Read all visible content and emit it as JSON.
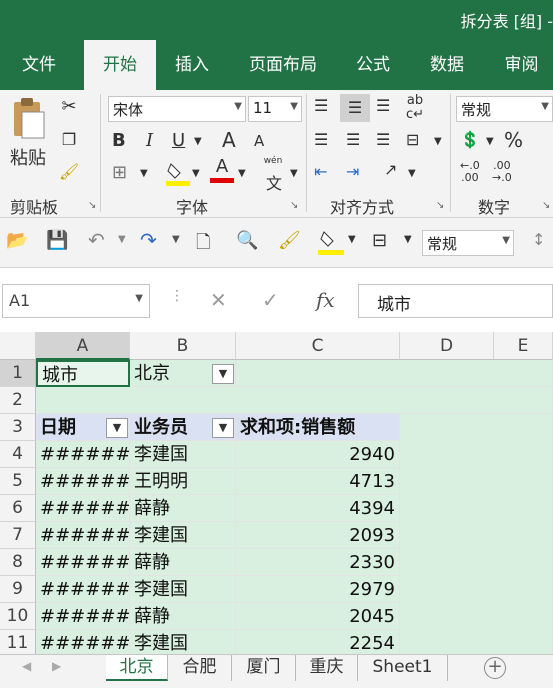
{
  "window": {
    "title": "拆分表 [组] -"
  },
  "tabs": [
    "文件",
    "开始",
    "插入",
    "页面布局",
    "公式",
    "数据",
    "审阅"
  ],
  "ribbon": {
    "clipboard": {
      "label": "剪贴板",
      "paste": "粘贴"
    },
    "font": {
      "label": "字体",
      "name": "宋体",
      "size": "11",
      "bold": "B",
      "italic": "I",
      "underline": "U",
      "grow": "A",
      "shrink": "A",
      "font_color": "A",
      "wen": "wén",
      "wen_char": "文"
    },
    "align": {
      "label": "对齐方式"
    },
    "number": {
      "label": "数字",
      "format": "常规",
      "percent": "%"
    }
  },
  "qat": {
    "format": "常规"
  },
  "formula_bar": {
    "name_box": "A1",
    "fx": "fx",
    "value": "城市"
  },
  "columns": [
    "A",
    "B",
    "C",
    "D",
    "E"
  ],
  "rows": [
    "1",
    "2",
    "3",
    "4",
    "5",
    "6",
    "7",
    "8",
    "9",
    "10",
    "11"
  ],
  "pivot": {
    "filter_label": "城市",
    "filter_value": "北京",
    "headers": [
      "日期",
      "业务员",
      "求和项:销售额"
    ],
    "data": [
      {
        "date": "#######",
        "person": "李建国",
        "amount": "2940"
      },
      {
        "date": "#######",
        "person": "王明明",
        "amount": "4713"
      },
      {
        "date": "#######",
        "person": "薛静",
        "amount": "4394"
      },
      {
        "date": "#######",
        "person": "李建国",
        "amount": "2093"
      },
      {
        "date": "#######",
        "person": "薛静",
        "amount": "2330"
      },
      {
        "date": "#######",
        "person": "李建国",
        "amount": "2979"
      },
      {
        "date": "#######",
        "person": "薛静",
        "amount": "2045"
      },
      {
        "date": "#######",
        "person": "李建国",
        "amount": "2254"
      }
    ]
  },
  "sheets": [
    "北京",
    "合肥",
    "厦门",
    "重庆",
    "Sheet1"
  ],
  "colors": {
    "accent": "#217346",
    "pivot_green": "#d9efdf",
    "pivot_header": "#d9e1f2"
  }
}
